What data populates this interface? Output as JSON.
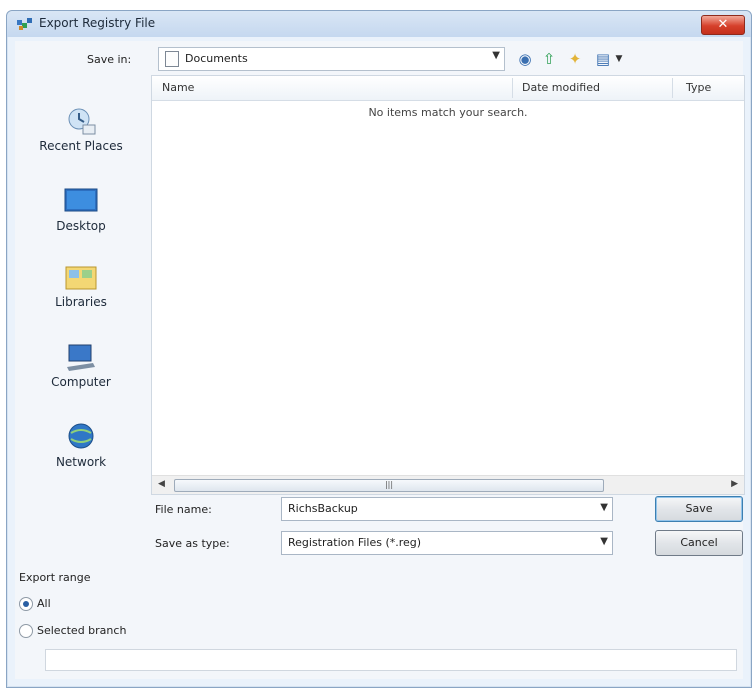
{
  "window": {
    "title": "Export Registry File",
    "close_label": "✕"
  },
  "toolbar": {
    "save_in_label": "Save in:",
    "location": "Documents",
    "icons": [
      "back-icon",
      "up-folder-icon",
      "new-folder-icon",
      "view-menu-icon"
    ]
  },
  "places": [
    {
      "label": "Recent Places",
      "icon": "recent-places-icon"
    },
    {
      "label": "Desktop",
      "icon": "desktop-icon"
    },
    {
      "label": "Libraries",
      "icon": "libraries-icon"
    },
    {
      "label": "Computer",
      "icon": "computer-icon"
    },
    {
      "label": "Network",
      "icon": "network-icon"
    }
  ],
  "file_list": {
    "columns": [
      "Name",
      "Date modified",
      "Type"
    ],
    "empty_message": "No items match your search."
  },
  "form": {
    "file_name_label": "File name:",
    "file_name_value": "RichsBackup",
    "save_type_label": "Save as type:",
    "save_type_value": "Registration Files (*.reg)",
    "save_button": "Save",
    "cancel_button": "Cancel"
  },
  "export_range": {
    "title": "Export range",
    "options": [
      "All",
      "Selected branch"
    ],
    "selected": "All",
    "branch_value": ""
  },
  "colors": {
    "accent": "#3c7fb1",
    "close": "#d6402b",
    "window_bg": "#eaf2fb"
  }
}
